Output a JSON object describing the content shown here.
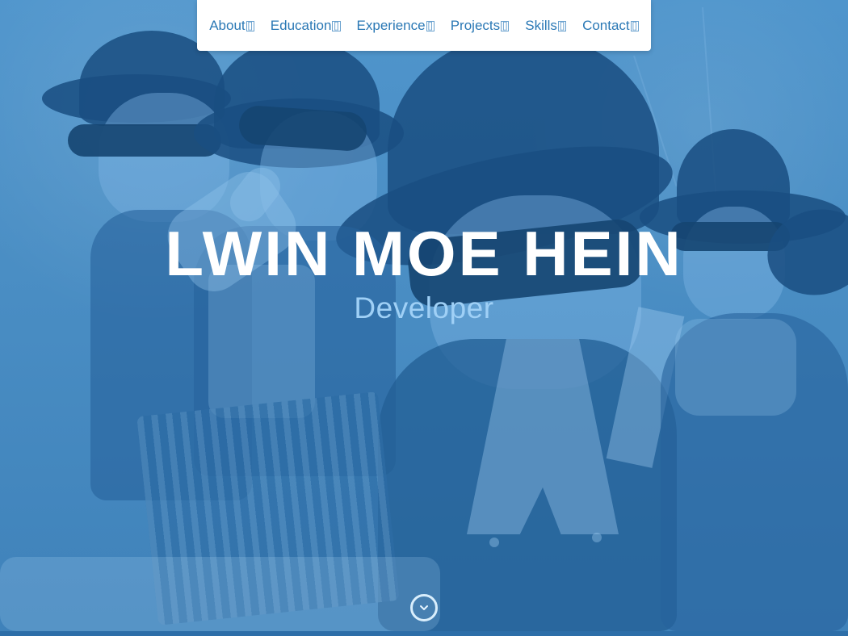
{
  "nav": {
    "items": [
      {
        "label": "About",
        "suffix": "[]"
      },
      {
        "label": "Education",
        "suffix": "[]"
      },
      {
        "label": "Experience",
        "suffix": "[]"
      },
      {
        "label": "Projects",
        "suffix": "[]"
      },
      {
        "label": "Skills",
        "suffix": "[]"
      },
      {
        "label": "Contact",
        "suffix": "[]"
      }
    ]
  },
  "hero": {
    "title": "LWIN MOE HEIN",
    "subtitle": "Developer",
    "scroll_icon": "chevron-down-icon"
  },
  "colors": {
    "nav_text": "#2a78b5",
    "hero_overlay": "#4a8fc5",
    "subtitle": "#9fd0f6",
    "bottom_bar": "#2d6ea8"
  }
}
